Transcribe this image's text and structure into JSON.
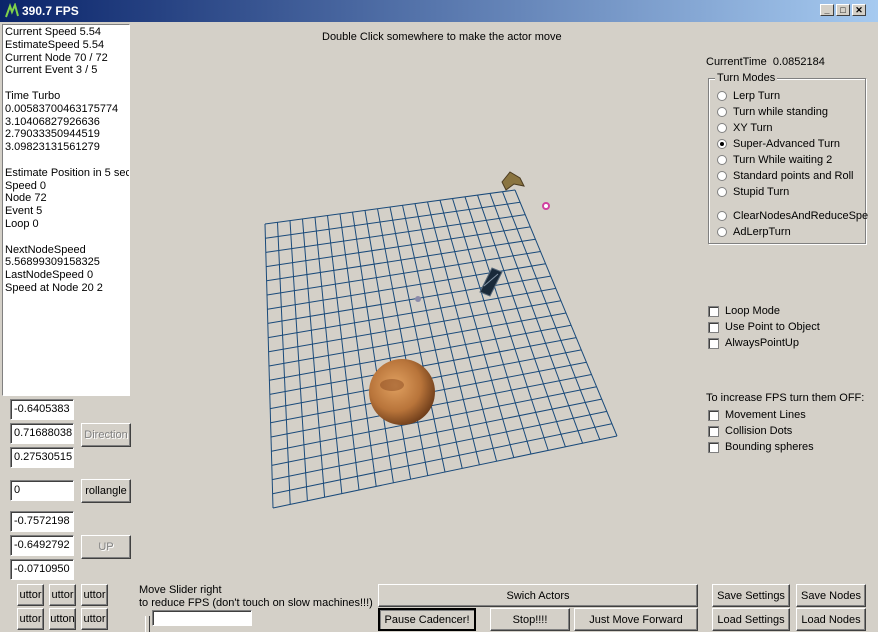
{
  "window": {
    "title": "390.7 FPS",
    "controls": {
      "minimize": "_",
      "maximize": "□",
      "close": "✕"
    }
  },
  "info_panel": {
    "lines": [
      "Current Speed  5.54",
      "EstimateSpeed  5.54",
      "Current Node   70 / 72",
      "Current Event  3 / 5",
      "",
      "Time Turbo",
      "0.00583700463175774",
      "3.10406827926636",
      "2.79033350944519",
      "3.09823131561279",
      "",
      "Estimate Position in 5 sec",
      "Speed  0",
      "Node  72",
      "Event 5",
      "Loop  0",
      "",
      "NextNodeSpeed",
      "5.56899309158325",
      "LastNodeSpeed 0",
      "Speed at Node 20 2"
    ]
  },
  "direction": {
    "x": "-0.6405383",
    "y": "0.71688038",
    "z": "0.27530515",
    "button": "Direction"
  },
  "roll": {
    "value": "0",
    "button": "rollangle"
  },
  "up": {
    "x": "-0.7572198",
    "y": "-0.6492792",
    "z": "-0.0710950",
    "button": "UP"
  },
  "small_buttons": [
    "uttor",
    "uttor",
    "uttor",
    "uttor",
    "utton",
    "uttor"
  ],
  "viewport": {
    "hint": "Double Click somewhere to make the actor move",
    "grid_color": "#1a4a7a"
  },
  "right_panel": {
    "current_time_label": "CurrentTime",
    "current_time_value": "0.0852184",
    "turn_modes_title": "Turn Modes",
    "turn_modes": [
      {
        "label": "Lerp Turn",
        "selected": false
      },
      {
        "label": "Turn while standing",
        "selected": false
      },
      {
        "label": "XY Turn",
        "selected": false
      },
      {
        "label": "Super-Advanced Turn",
        "selected": true
      },
      {
        "label": "Turn While waiting 2",
        "selected": false
      },
      {
        "label": "Standard points and Roll",
        "selected": false
      },
      {
        "label": "Stupid Turn",
        "selected": false
      },
      {
        "label": "ClearNodesAndReduceSpe",
        "selected": false
      },
      {
        "label": "AdLerpTurn",
        "selected": false
      }
    ],
    "options": [
      "Loop Mode",
      "Use Point to Object",
      "AlwaysPointUp"
    ],
    "fps_hint": "To increase FPS turn them OFF:",
    "fps_options": [
      "Movement Lines",
      "Collision Dots",
      "Bounding spheres"
    ]
  },
  "bottom": {
    "slider_line1": "Move Slider right",
    "slider_line2": "to reduce FPS (don't touch on slow machines!!!)",
    "switch_actors": "Swich Actors",
    "pause": "Pause Cadencer!",
    "stop": "Stop!!!!",
    "move_forward": "Just Move Forward",
    "save_settings": "Save Settings",
    "save_nodes": "Save Nodes",
    "load_settings": "Load Settings",
    "load_nodes": "Load Nodes"
  }
}
